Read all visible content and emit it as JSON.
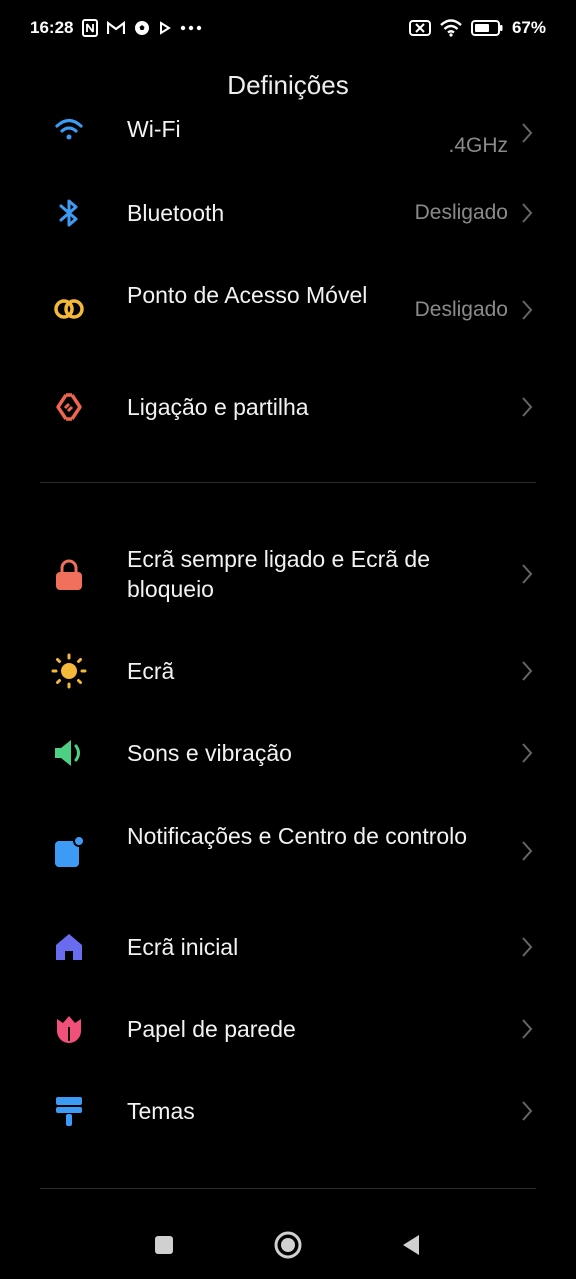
{
  "status_bar": {
    "time": "16:28",
    "battery": "67%"
  },
  "header": {
    "title": "Definições"
  },
  "items": [
    {
      "id": "wifi",
      "label": "Wi-Fi",
      "value": ".4GHz"
    },
    {
      "id": "bluetooth",
      "label": "Bluetooth",
      "value": "Desligado"
    },
    {
      "id": "hotspot",
      "label": "Ponto de Acesso Móvel",
      "value": "Desligado"
    },
    {
      "id": "connection",
      "label": "Ligação e partilha",
      "value": ""
    },
    {
      "id": "lockscreen",
      "label": "Ecrã sempre ligado e Ecrã de bloqueio",
      "value": ""
    },
    {
      "id": "display",
      "label": "Ecrã",
      "value": ""
    },
    {
      "id": "sound",
      "label": "Sons e vibração",
      "value": ""
    },
    {
      "id": "notifications",
      "label": "Notificações e Centro de controlo",
      "value": ""
    },
    {
      "id": "home",
      "label": "Ecrã inicial",
      "value": ""
    },
    {
      "id": "wallpaper",
      "label": "Papel de parede",
      "value": ""
    },
    {
      "id": "themes",
      "label": "Temas",
      "value": ""
    }
  ],
  "colors": {
    "wifi": "#3d9bf5",
    "bluetooth": "#3d9bf5",
    "hotspot": "#f5b93a",
    "connection": "#f0654e",
    "lockscreen": "#f0705c",
    "display": "#f5b93a",
    "sound": "#4dd084",
    "notifications": "#3d9bf5",
    "home": "#6a6cf0",
    "wallpaper": "#f0507a",
    "themes": "#3d9bf5"
  }
}
